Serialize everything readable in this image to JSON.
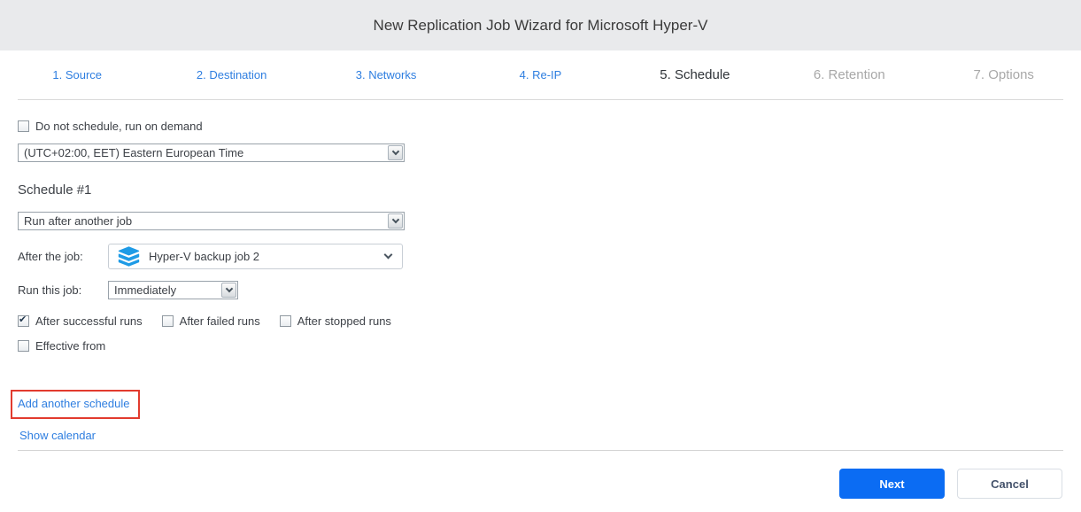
{
  "header": {
    "title": "New Replication Job Wizard for Microsoft Hyper-V"
  },
  "tabs": [
    {
      "label": "1. Source",
      "state": "link"
    },
    {
      "label": "2. Destination",
      "state": "link"
    },
    {
      "label": "3. Networks",
      "state": "link"
    },
    {
      "label": "4. Re-IP",
      "state": "link"
    },
    {
      "label": "5. Schedule",
      "state": "active"
    },
    {
      "label": "6. Retention",
      "state": "disabled"
    },
    {
      "label": "7. Options",
      "state": "disabled"
    }
  ],
  "schedule": {
    "do_not_schedule": {
      "label": "Do not schedule, run on demand",
      "checked": false
    },
    "timezone_value": "(UTC+02:00, EET) Eastern European Time",
    "section_title": "Schedule #1",
    "type_value": "Run after another job",
    "after_job_label": "After the job:",
    "after_job_value": "Hyper-V backup job 2",
    "after_job_icon": "layers-icon",
    "run_this_job_label": "Run this job:",
    "run_this_job_value": "Immediately",
    "run_conditions": [
      {
        "label": "After successful runs",
        "checked": true
      },
      {
        "label": "After failed runs",
        "checked": false
      },
      {
        "label": "After stopped runs",
        "checked": false
      }
    ],
    "effective_from": {
      "label": "Effective from",
      "checked": false
    },
    "add_schedule_link": "Add another schedule",
    "show_calendar_link": "Show calendar"
  },
  "footer": {
    "next_label": "Next",
    "cancel_label": "Cancel"
  },
  "colors": {
    "accent_blue": "#0b6cf3",
    "link_blue": "#2e7ee0",
    "header_bg": "#e9eaec",
    "annotation_red": "#e23b2e",
    "job_icon_blue": "#1e9be6"
  }
}
